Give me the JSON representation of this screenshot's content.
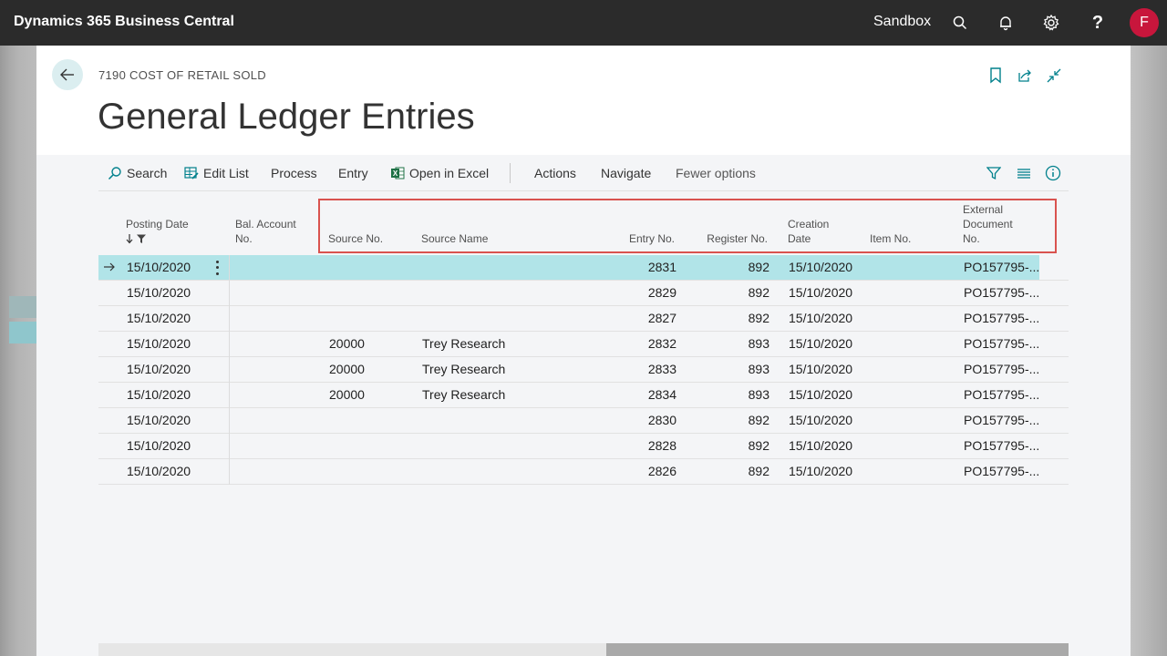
{
  "topbar": {
    "app_name": "Dynamics 365 Business Central",
    "environment": "Sandbox",
    "avatar_initial": "F",
    "icons": [
      "search-icon",
      "bell-icon",
      "gear-icon",
      "help-icon"
    ]
  },
  "page": {
    "caption": "7190 COST OF RETAIL SOLD",
    "title": "General Ledger Entries",
    "header_icons": [
      "bookmark-icon",
      "open-new-window-icon",
      "collapse-icon"
    ]
  },
  "actions": {
    "search": "Search",
    "edit_list": "Edit List",
    "process": "Process",
    "entry": "Entry",
    "open_in_excel": "Open in Excel",
    "actions": "Actions",
    "navigate": "Navigate",
    "fewer_options": "Fewer options",
    "right_icons": [
      "filter-icon",
      "list-view-icon",
      "info-icon"
    ]
  },
  "columns": {
    "posting_date": "Posting Date",
    "bal_account_line1": "Bal. Account",
    "bal_account_line2": "No.",
    "source_no": "Source No.",
    "source_name": "Source Name",
    "entry_no": "Entry No.",
    "register_no": "Register No.",
    "creation_line1": "Creation",
    "creation_line2": "Date",
    "item_no": "Item No.",
    "ext_line1": "External",
    "ext_line2": "Document",
    "ext_line3": "No."
  },
  "rows": [
    {
      "posting_date": "15/10/2020",
      "source_no": "",
      "source_name": "",
      "entry_no": "2831",
      "register_no": "892",
      "creation_date": "15/10/2020",
      "item_no": "",
      "ext_doc": "PO157795-..."
    },
    {
      "posting_date": "15/10/2020",
      "source_no": "",
      "source_name": "",
      "entry_no": "2829",
      "register_no": "892",
      "creation_date": "15/10/2020",
      "item_no": "",
      "ext_doc": "PO157795-..."
    },
    {
      "posting_date": "15/10/2020",
      "source_no": "",
      "source_name": "",
      "entry_no": "2827",
      "register_no": "892",
      "creation_date": "15/10/2020",
      "item_no": "",
      "ext_doc": "PO157795-..."
    },
    {
      "posting_date": "15/10/2020",
      "source_no": "20000",
      "source_name": "Trey Research",
      "entry_no": "2832",
      "register_no": "893",
      "creation_date": "15/10/2020",
      "item_no": "",
      "ext_doc": "PO157795-..."
    },
    {
      "posting_date": "15/10/2020",
      "source_no": "20000",
      "source_name": "Trey Research",
      "entry_no": "2833",
      "register_no": "893",
      "creation_date": "15/10/2020",
      "item_no": "",
      "ext_doc": "PO157795-..."
    },
    {
      "posting_date": "15/10/2020",
      "source_no": "20000",
      "source_name": "Trey Research",
      "entry_no": "2834",
      "register_no": "893",
      "creation_date": "15/10/2020",
      "item_no": "",
      "ext_doc": "PO157795-..."
    },
    {
      "posting_date": "15/10/2020",
      "source_no": "",
      "source_name": "",
      "entry_no": "2830",
      "register_no": "892",
      "creation_date": "15/10/2020",
      "item_no": "",
      "ext_doc": "PO157795-..."
    },
    {
      "posting_date": "15/10/2020",
      "source_no": "",
      "source_name": "",
      "entry_no": "2828",
      "register_no": "892",
      "creation_date": "15/10/2020",
      "item_no": "",
      "ext_doc": "PO157795-..."
    },
    {
      "posting_date": "15/10/2020",
      "source_no": "",
      "source_name": "",
      "entry_no": "2826",
      "register_no": "892",
      "creation_date": "15/10/2020",
      "item_no": "",
      "ext_doc": "PO157795-..."
    }
  ],
  "colors": {
    "topbar": "#2b2b2b",
    "accent": "#00808c",
    "selected_row": "#b1e4e8",
    "highlight_border": "#d9534f",
    "avatar": "#c8163c"
  }
}
